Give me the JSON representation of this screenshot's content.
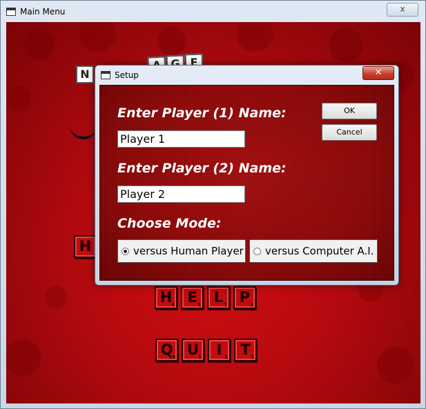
{
  "main_window": {
    "title": "Main Menu",
    "close_label": "x"
  },
  "background_tiles": {
    "top_left": [
      "N",
      "A",
      "G",
      "E"
    ],
    "partial_left": "H",
    "help": [
      {
        "letter": "H",
        "points": "4"
      },
      {
        "letter": "E",
        "points": "1"
      },
      {
        "letter": "L",
        "points": "1"
      },
      {
        "letter": "P",
        "points": "3"
      }
    ],
    "quit": [
      {
        "letter": "Q",
        "points": "10"
      },
      {
        "letter": "U",
        "points": "1"
      },
      {
        "letter": "I",
        "points": "1"
      },
      {
        "letter": "T",
        "points": "1"
      }
    ]
  },
  "setup_dialog": {
    "title": "Setup",
    "close_label": "✕",
    "player1_label": "Enter Player (1) Name:",
    "player1_value": "Player 1",
    "player2_label": "Enter Player (2) Name:",
    "player2_value": "Player 2",
    "mode_label": "Choose Mode:",
    "ok_label": "OK",
    "cancel_label": "Cancel",
    "mode_options": [
      {
        "label": "versus Human Player",
        "selected": true
      },
      {
        "label": "versus Computer A.I.",
        "selected": false
      }
    ]
  }
}
